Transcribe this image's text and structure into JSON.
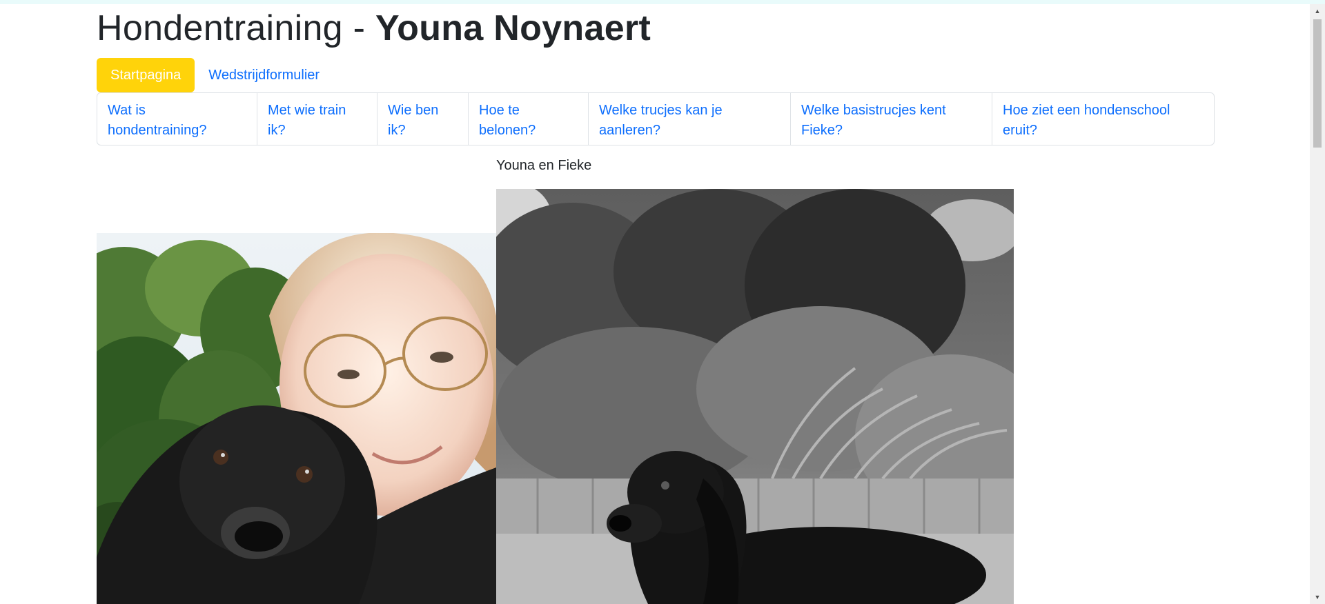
{
  "header": {
    "title_prefix": "Hondentraining - ",
    "title_name": "Youna Noynaert"
  },
  "nav_pills": [
    {
      "label": "Startpagina",
      "active": true
    },
    {
      "label": "Wedstrijdformulier",
      "active": false
    }
  ],
  "tabs": [
    {
      "label": "Wat is hondentraining?"
    },
    {
      "label": "Met wie train ik?"
    },
    {
      "label": "Wie ben ik?"
    },
    {
      "label": "Hoe te belonen?"
    },
    {
      "label": "Welke trucjes kan je aanleren?"
    },
    {
      "label": "Welke basistrucjes kent Fieke?"
    },
    {
      "label": "Hoe ziet een hondenschool eruit?"
    }
  ],
  "content": {
    "caption": "Youna en Fieke"
  },
  "colors": {
    "accent": "#ffd30a",
    "link": "#0d6efd",
    "text": "#212529",
    "border": "#dee2e6"
  }
}
